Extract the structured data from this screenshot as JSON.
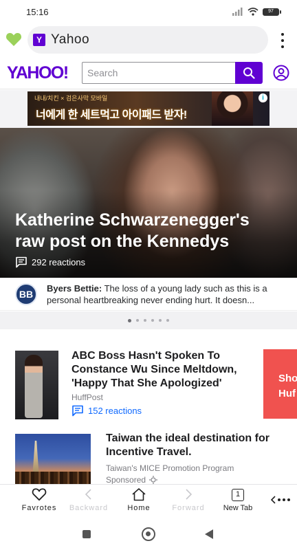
{
  "status_bar": {
    "time": "15:16",
    "battery": "97"
  },
  "browser": {
    "url_title": "Yahoo",
    "favicon_letter": "Y"
  },
  "yahoo": {
    "logo": "YAHOO!",
    "search_placeholder": "Search",
    "brand_color": "#6001d2"
  },
  "ad": {
    "top_text": "내내/치킨 × 검은사막 모바일",
    "main_text": "너에게 한 세트먹고 아이패드 받자!",
    "info_icon": "i"
  },
  "hero": {
    "title": "Katherine Schwarzenegger's raw post on the Kennedys",
    "reactions": "292 reactions"
  },
  "comment": {
    "avatar_initials": "BB",
    "author": "Byers Bettie:",
    "text": " The loss of a young lady such as this is a personal heartbreaking never ending hurt. It doesn..."
  },
  "carousel": {
    "dot_count": 6,
    "active_index": 0
  },
  "articles": [
    {
      "title": "ABC Boss Hasn't Spoken To Constance Wu Since Meltdown, 'Happy That She Apologized'",
      "source": "HuffPost",
      "reactions": "152 reactions"
    },
    {
      "title": "Taiwan the ideal destination for Incentive Travel.",
      "source": "Taiwan's MICE Promotion Program",
      "sponsored": "Sponsored"
    }
  ],
  "side_ad": {
    "text": "Sho Huf"
  },
  "toolbar": {
    "favorites": "Favrotes",
    "backward": "Backward",
    "home": "Home",
    "forward": "Forward",
    "new_tab": "New Tab",
    "tab_count": "1"
  },
  "colors": {
    "accent": "#6001d2",
    "link": "#0f69ff",
    "favorite_heart": "#9bd15a",
    "side_ad": "#f0524f"
  }
}
